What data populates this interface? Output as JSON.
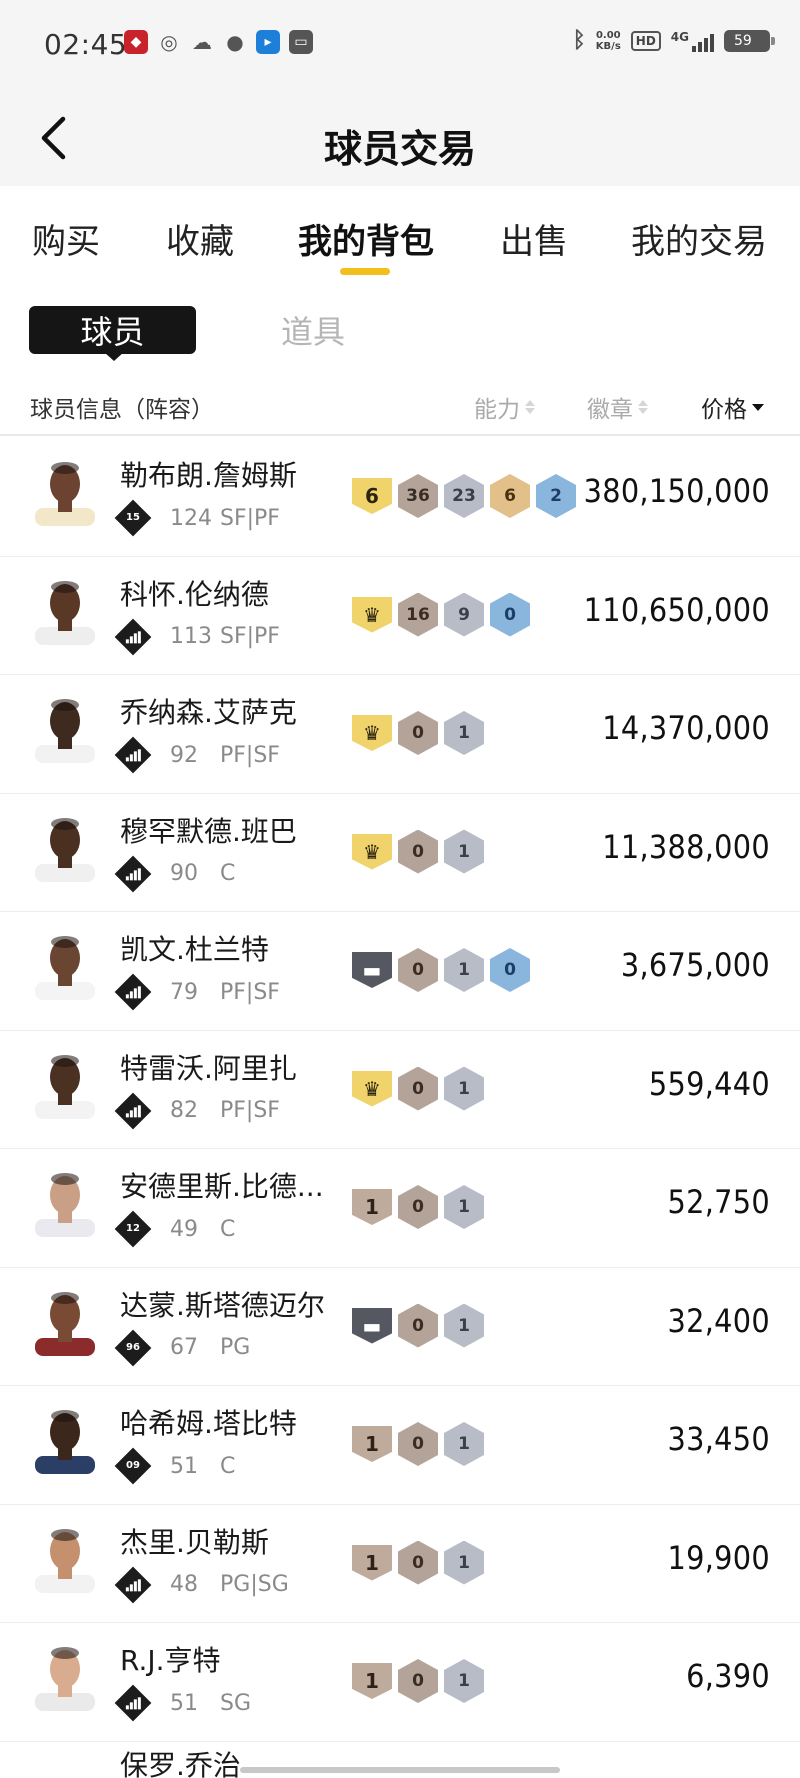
{
  "status_bar": {
    "time": "02:45",
    "net_speed": "0.00",
    "net_unit": "KB/s",
    "hd": "HD",
    "signal": "4G",
    "battery": "59"
  },
  "header": {
    "title": "球员交易"
  },
  "tabs": [
    {
      "label": "购买"
    },
    {
      "label": "收藏"
    },
    {
      "label": "我的背包"
    },
    {
      "label": "出售"
    },
    {
      "label": "我的交易"
    }
  ],
  "active_tab_index": 2,
  "segment": {
    "active": "球员",
    "inactive": "道具"
  },
  "columns": {
    "info": "球员信息（阵容）",
    "ability": "能力",
    "badges": "徽章",
    "price": "价格"
  },
  "players": [
    {
      "name": "勒布朗.詹姆斯",
      "rank": "15",
      "ovr": "124",
      "pos": "SF|PF",
      "price": "380,150,000",
      "badges": [
        {
          "shape": "shield",
          "color": "yellow",
          "text": "6"
        },
        {
          "shape": "hex",
          "color": "brown",
          "text": "36"
        },
        {
          "shape": "hex",
          "color": "silver",
          "text": "23"
        },
        {
          "shape": "hex",
          "color": "gold",
          "text": "6"
        },
        {
          "shape": "hex",
          "color": "blue",
          "text": "2"
        }
      ]
    },
    {
      "name": "科怀.伦纳德",
      "rank": "bars",
      "ovr": "113",
      "pos": "SF|PF",
      "price": "110,650,000",
      "badges": [
        {
          "shape": "shield",
          "color": "yellow",
          "text": "♛"
        },
        {
          "shape": "hex",
          "color": "brown",
          "text": "16"
        },
        {
          "shape": "hex",
          "color": "silver",
          "text": "9"
        },
        {
          "shape": "hex",
          "color": "blue",
          "text": "0"
        }
      ]
    },
    {
      "name": "乔纳森.艾萨克",
      "rank": "bars",
      "ovr": "92",
      "pos": "PF|SF",
      "price": "14,370,000",
      "badges": [
        {
          "shape": "shield",
          "color": "yellow",
          "text": "♛"
        },
        {
          "shape": "hex",
          "color": "brown",
          "text": "0"
        },
        {
          "shape": "hex",
          "color": "silver",
          "text": "1"
        }
      ]
    },
    {
      "name": "穆罕默德.班巴",
      "rank": "bars",
      "ovr": "90",
      "pos": "C",
      "price": "11,388,000",
      "badges": [
        {
          "shape": "shield",
          "color": "yellow",
          "text": "♛"
        },
        {
          "shape": "hex",
          "color": "brown",
          "text": "0"
        },
        {
          "shape": "hex",
          "color": "silver",
          "text": "1"
        }
      ]
    },
    {
      "name": "凯文.杜兰特",
      "rank": "bars",
      "ovr": "79",
      "pos": "PF|SF",
      "price": "3,675,000",
      "badges": [
        {
          "shape": "shield",
          "color": "dark",
          "text": "▬"
        },
        {
          "shape": "hex",
          "color": "brown",
          "text": "0"
        },
        {
          "shape": "hex",
          "color": "silver",
          "text": "1"
        },
        {
          "shape": "hex",
          "color": "blue",
          "text": "0"
        }
      ]
    },
    {
      "name": "特雷沃.阿里扎",
      "rank": "bars",
      "ovr": "82",
      "pos": "PF|SF",
      "price": "559,440",
      "badges": [
        {
          "shape": "shield",
          "color": "yellow",
          "text": "♛"
        },
        {
          "shape": "hex",
          "color": "brown",
          "text": "0"
        },
        {
          "shape": "hex",
          "color": "silver",
          "text": "1"
        }
      ]
    },
    {
      "name": "安德里斯.比德...",
      "rank": "12",
      "ovr": "49",
      "pos": "C",
      "price": "52,750",
      "badges": [
        {
          "shape": "shield",
          "color": "bronze",
          "text": "1"
        },
        {
          "shape": "hex",
          "color": "brown",
          "text": "0"
        },
        {
          "shape": "hex",
          "color": "silver",
          "text": "1"
        }
      ]
    },
    {
      "name": "达蒙.斯塔德迈尔",
      "rank": "96",
      "ovr": "67",
      "pos": "PG",
      "price": "32,400",
      "badges": [
        {
          "shape": "shield",
          "color": "dark",
          "text": "▬"
        },
        {
          "shape": "hex",
          "color": "brown",
          "text": "0"
        },
        {
          "shape": "hex",
          "color": "silver",
          "text": "1"
        }
      ]
    },
    {
      "name": "哈希姆.塔比特",
      "rank": "09",
      "ovr": "51",
      "pos": "C",
      "price": "33,450",
      "badges": [
        {
          "shape": "shield",
          "color": "bronze",
          "text": "1"
        },
        {
          "shape": "hex",
          "color": "brown",
          "text": "0"
        },
        {
          "shape": "hex",
          "color": "silver",
          "text": "1"
        }
      ]
    },
    {
      "name": "杰里.贝勒斯",
      "rank": "bars",
      "ovr": "48",
      "pos": "PG|SG",
      "price": "19,900",
      "badges": [
        {
          "shape": "shield",
          "color": "bronze",
          "text": "1"
        },
        {
          "shape": "hex",
          "color": "brown",
          "text": "0"
        },
        {
          "shape": "hex",
          "color": "silver",
          "text": "1"
        }
      ]
    },
    {
      "name": "R.J.亨特",
      "rank": "bars",
      "ovr": "51",
      "pos": "SG",
      "price": "6,390",
      "badges": [
        {
          "shape": "shield",
          "color": "bronze",
          "text": "1"
        },
        {
          "shape": "hex",
          "color": "brown",
          "text": "0"
        },
        {
          "shape": "hex",
          "color": "silver",
          "text": "1"
        }
      ]
    }
  ],
  "partial_player": {
    "name": "保罗.乔治"
  },
  "icons": {
    "back": "chevron-left-icon",
    "player_avatar": "player-avatar-icon"
  },
  "colors": {
    "accent": "#f2bf1c",
    "active_segment": "#151515"
  }
}
